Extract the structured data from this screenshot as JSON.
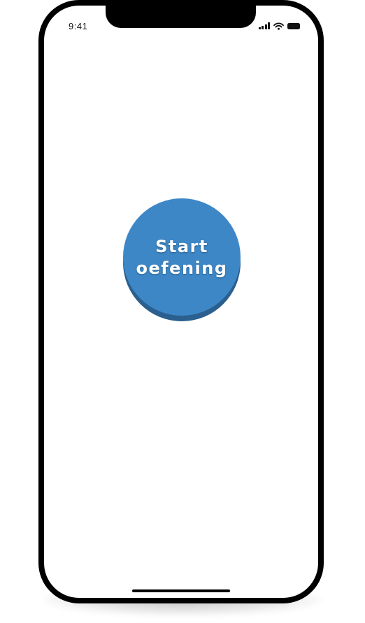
{
  "status_bar": {
    "time": "9:41",
    "icons": [
      "cellular-signal-icon",
      "wifi-icon",
      "battery-icon"
    ]
  },
  "main": {
    "start_button": {
      "line1": "Start",
      "line2": "oefening",
      "face_color": "#3d87c7",
      "base_color": "#2b5f8e",
      "text_color": "#ffffff"
    }
  }
}
